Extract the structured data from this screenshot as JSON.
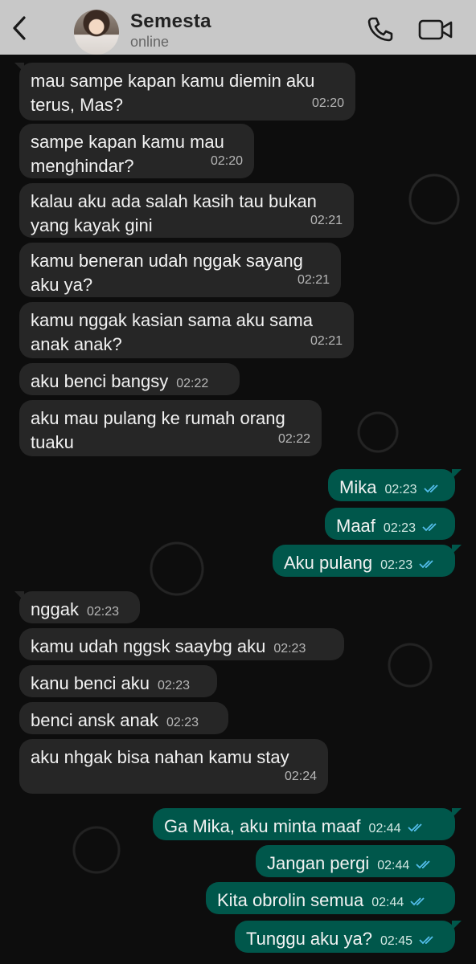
{
  "header": {
    "contact_name": "Semesta",
    "status": "online"
  },
  "colors": {
    "header_bg": "#c8c8c8",
    "incoming_bubble": "#262626",
    "outgoing_bubble": "#00574b",
    "read_tick": "#53bdeb"
  },
  "icons": {
    "back": "chevron-left-icon",
    "call": "phone-icon",
    "video": "video-camera-icon",
    "read": "double-check-icon"
  },
  "messages": [
    {
      "dir": "in",
      "text": "mau sampe kapan kamu diemin aku terus, Mas?",
      "time": "02:20"
    },
    {
      "dir": "in",
      "text": "sampe kapan kamu mau menghindar?",
      "time": "02:20"
    },
    {
      "dir": "in",
      "text": "kalau aku ada salah kasih tau bukan yang kayak gini",
      "time": "02:21"
    },
    {
      "dir": "in",
      "text": "kamu beneran udah nggak sayang aku ya?",
      "time": "02:21"
    },
    {
      "dir": "in",
      "text": "kamu nggak kasian sama aku sama anak anak?",
      "time": "02:21"
    },
    {
      "dir": "in",
      "text": "aku benci bangsy",
      "time": "02:22"
    },
    {
      "dir": "in",
      "text": "aku mau pulang ke rumah orang tuaku",
      "time": "02:22"
    },
    {
      "dir": "out",
      "text": "Mika",
      "time": "02:23",
      "read": true
    },
    {
      "dir": "out",
      "text": "Maaf",
      "time": "02:23",
      "read": true
    },
    {
      "dir": "out",
      "text": "Aku pulang",
      "time": "02:23",
      "read": true
    },
    {
      "dir": "in",
      "text": "nggak",
      "time": "02:23"
    },
    {
      "dir": "in",
      "text": "kamu udah nggsk saaybg aku",
      "time": "02:23"
    },
    {
      "dir": "in",
      "text": "kanu benci aku",
      "time": "02:23"
    },
    {
      "dir": "in",
      "text": "benci ansk anak",
      "time": "02:23"
    },
    {
      "dir": "in",
      "text": "aku nhgak bisa nahan kamu stay",
      "time": "02:24"
    },
    {
      "dir": "out",
      "text": "Ga Mika, aku minta maaf",
      "time": "02:44",
      "read": true
    },
    {
      "dir": "out",
      "text": "Jangan pergi",
      "time": "02:44",
      "read": true
    },
    {
      "dir": "out",
      "text": "Kita obrolin semua",
      "time": "02:44",
      "read": true
    },
    {
      "dir": "out",
      "text": "Tunggu aku ya?",
      "time": "02:45",
      "read": true
    }
  ]
}
